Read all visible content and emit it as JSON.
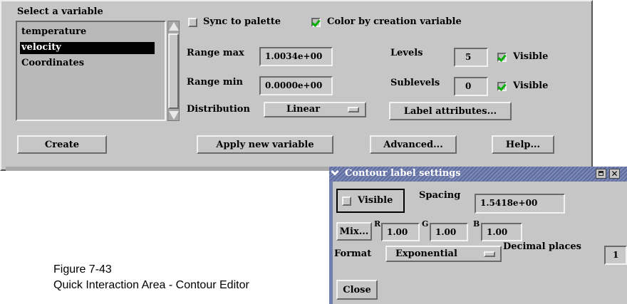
{
  "main": {
    "group_label": "Select a variable",
    "variables": [
      "temperature",
      "velocity",
      "Coordinates"
    ],
    "selected_variable": "velocity",
    "sync_palette": {
      "label": "Sync to palette",
      "checked": false
    },
    "color_by_creation": {
      "label": "Color by creation variable",
      "checked": true
    },
    "range_max": {
      "label": "Range max",
      "value": "1.0034e+00"
    },
    "range_min": {
      "label": "Range min",
      "value": "0.0000e+00"
    },
    "distribution": {
      "label": "Distribution",
      "value": "Linear"
    },
    "levels": {
      "label": "Levels",
      "value": "5",
      "visible_label": "Visible",
      "visible": true
    },
    "sublevels": {
      "label": "Sublevels",
      "value": "0",
      "visible_label": "Visible",
      "visible": true
    },
    "label_attributes_button": "Label attributes...",
    "create_button": "Create",
    "apply_button": "Apply new variable",
    "advanced_button": "Advanced...",
    "help_button": "Help..."
  },
  "dialog": {
    "title": "Contour label settings",
    "visible": {
      "label": "Visible",
      "checked": false
    },
    "spacing": {
      "label": "Spacing",
      "value": "1.5418e+00"
    },
    "mix_button": "Mix...",
    "r": {
      "label": "R",
      "value": "1.00"
    },
    "g": {
      "label": "G",
      "value": "1.00"
    },
    "b": {
      "label": "B",
      "value": "1.00"
    },
    "format": {
      "label": "Format",
      "value": "Exponential"
    },
    "decimal_places": {
      "label": "Decimal places",
      "value": "1"
    },
    "close_button": "Close"
  },
  "caption": {
    "figure": "Figure 7-43",
    "text": "Quick Interaction Area - Contour Editor"
  }
}
